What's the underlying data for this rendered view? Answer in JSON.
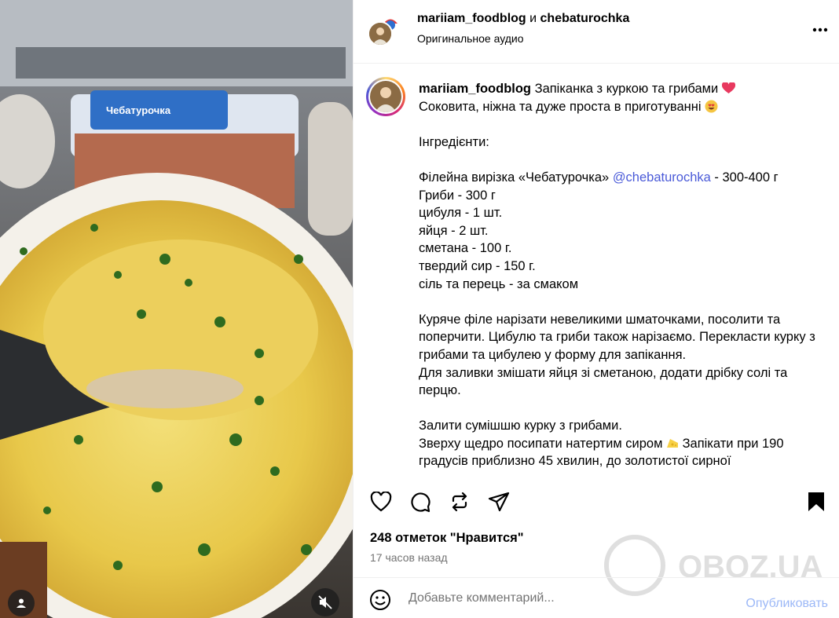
{
  "header": {
    "author": "mariiam_foodblog",
    "conjunction": "и",
    "coauthor": "chebaturochka",
    "audio": "Оригинальное аудио"
  },
  "caption": {
    "username": "mariiam_foodblog",
    "line1": " Запіканка з куркою та грибами ",
    "line2": "Соковита, ніжна та дуже проста в приготуванні ",
    "ingredients_title": "Інгредієнти:",
    "ing1_prefix": "Філейна вирізка «Чебатурочка» ",
    "ing1_mention": "@chebaturochka",
    "ing1_suffix": " - 300-400 г",
    "ing2": "Гриби - 300 г",
    "ing3": "цибуля - 1 шт.",
    "ing4": "яйця - 2 шт.",
    "ing5": "сметана - 100 г.",
    "ing6": "твердий сир - 150 г.",
    "ing7": "сіль та перець - за смаком",
    "step1": "Куряче філе нарізати невеликими шматочками, посолити та поперчити. Цибулю та гриби також нарізаємо. Перекласти курку з грибами та цибулею у форму для запікання.\nДля заливки змішати яйця зі сметаною, додати дрібку солі та перцю.",
    "step2a": "Залити сумішшю курку з грибами.",
    "step2b": "Зверху щедро посипати натертим сиром ",
    "step2c": " Запікати при 190 градусів приблизно 45 хвилин, до золотистої сирної"
  },
  "engagement": {
    "likes": "248 отметок \"Нравится\"",
    "time_ago": "17 часов назад"
  },
  "comment": {
    "placeholder": "Добавьте комментарий...",
    "publish": "Опубликовать"
  },
  "media": {
    "package_label": "Чебатурочка",
    "watermark": "OBOZ.UA"
  },
  "icons": [
    "heart-icon",
    "comment-icon",
    "repost-icon",
    "share-icon",
    "bookmark-icon",
    "more-icon",
    "emoji-icon",
    "person-tag-icon",
    "mute-icon"
  ],
  "colors": {
    "mention": "#4a5ad8",
    "publish": "#9cb8f7",
    "muted_text": "#737373"
  }
}
